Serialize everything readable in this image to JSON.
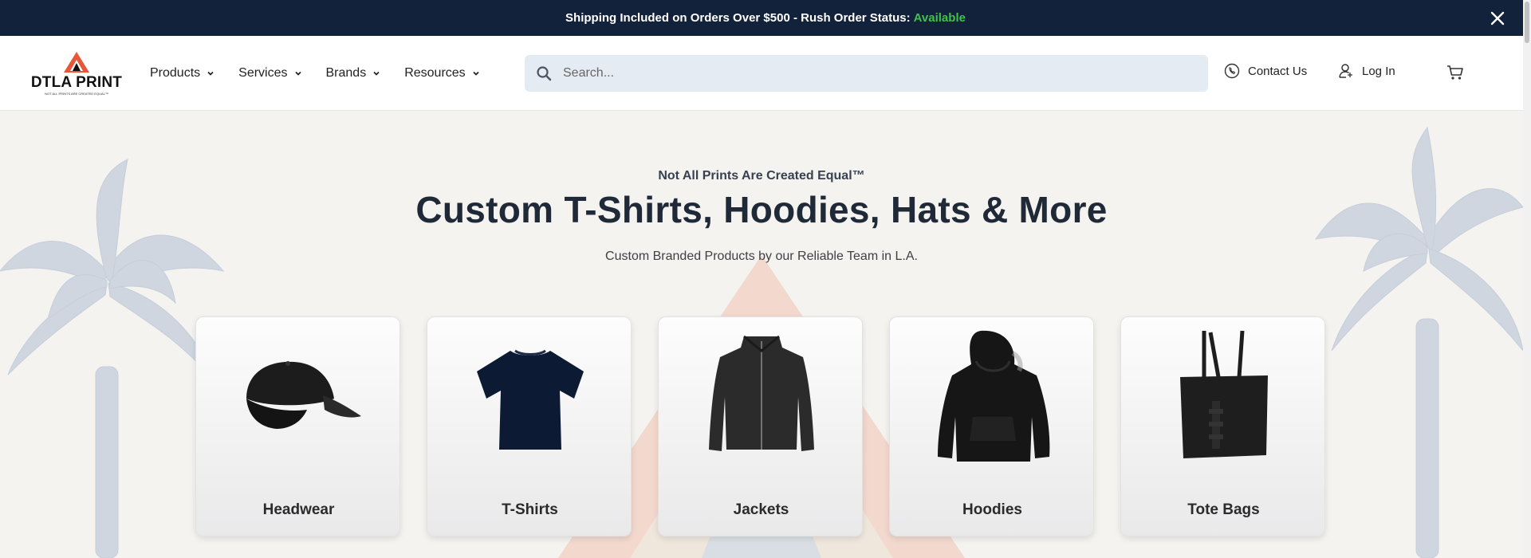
{
  "announcement": {
    "text": "Shipping Included on Orders Over $500 - Rush Order Status:",
    "status": "Available",
    "status_color": "#41c14a",
    "close_icon": "close-icon"
  },
  "header": {
    "logo": {
      "name": "DTLA PRINT",
      "tagline": "NOT ALL PRINTS ARE CREATED EQUAL™",
      "accent_color": "#e8563a"
    },
    "nav": [
      {
        "label": "Products"
      },
      {
        "label": "Services"
      },
      {
        "label": "Brands"
      },
      {
        "label": "Resources"
      }
    ],
    "search": {
      "placeholder": "Search...",
      "value": "",
      "icon": "search-icon"
    },
    "contact_label": "Contact Us",
    "login_label": "Log In",
    "cart_icon": "cart-icon"
  },
  "hero": {
    "tagline": "Not All Prints Are Created Equal™",
    "headline": "Custom T-Shirts, Hoodies, Hats & More",
    "subline": "Custom Branded Products by our Reliable Team in L.A."
  },
  "categories": [
    {
      "label": "Headwear",
      "icon": "cap-icon"
    },
    {
      "label": "T-Shirts",
      "icon": "tshirt-icon"
    },
    {
      "label": "Jackets",
      "icon": "jacket-icon"
    },
    {
      "label": "Hoodies",
      "icon": "hoodie-icon"
    },
    {
      "label": "Tote Bags",
      "icon": "tote-bag-icon"
    }
  ],
  "colors": {
    "announcement_bg": "#13223b",
    "page_bg": "#f4f3ef",
    "search_bg": "#e5ebf2"
  }
}
